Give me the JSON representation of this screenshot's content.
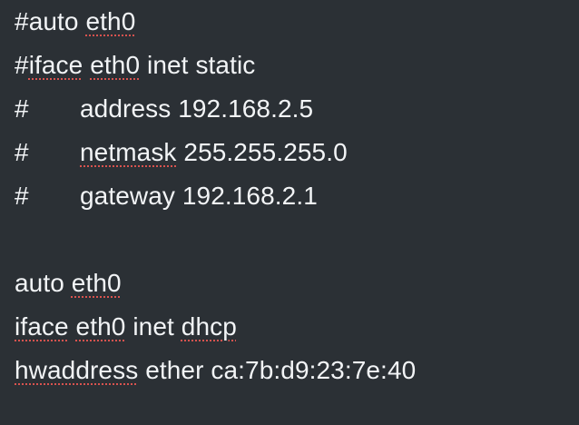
{
  "editor": {
    "lines": [
      {
        "hash": "#",
        "t1": "auto ",
        "s1": "eth0"
      },
      {
        "hash": "#",
        "s1": "iface",
        "t1": " ",
        "s2": "eth0",
        "t2": " inet static"
      },
      {
        "hash": "#",
        "text": "address 192.168.2.5"
      },
      {
        "hash": "#",
        "spell": "netmask",
        "text": " 255.255.255.0"
      },
      {
        "hash": "#",
        "text": "gateway 192.168.2.1"
      },
      {},
      {
        "t1": "auto ",
        "s1": "eth0"
      },
      {
        "s1": "iface",
        "t1": " ",
        "s2": "eth0",
        "t2": " inet ",
        "s3": "dhcp"
      },
      {
        "s1": "hwaddress",
        "t1": " ether ca:7b:d9:23:7e:40"
      }
    ]
  }
}
